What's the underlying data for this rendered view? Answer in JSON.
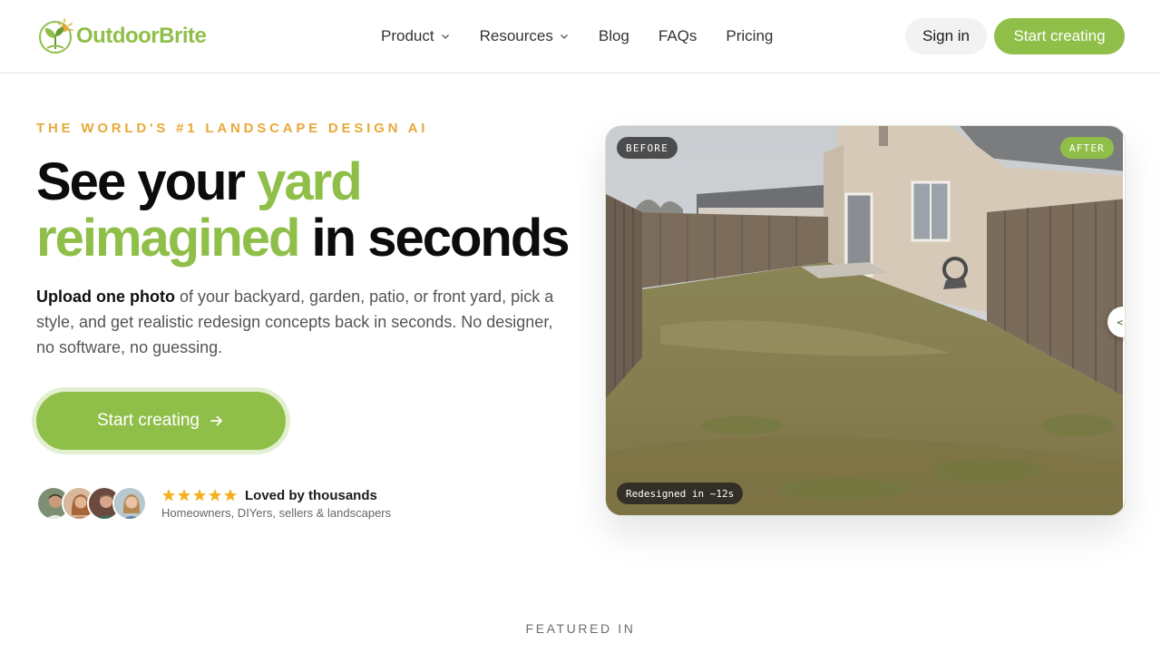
{
  "brand": {
    "name_part1": "Outdoor",
    "name_part2": "Brite",
    "colors": {
      "green": "#8fbf49",
      "orange": "#e8a93a",
      "dark": "#0c0c0c"
    }
  },
  "nav": {
    "items": [
      {
        "label": "Product",
        "has_dropdown": true
      },
      {
        "label": "Resources",
        "has_dropdown": true
      },
      {
        "label": "Blog",
        "has_dropdown": false
      },
      {
        "label": "FAQs",
        "has_dropdown": false
      },
      {
        "label": "Pricing",
        "has_dropdown": false
      }
    ],
    "sign_in": "Sign in",
    "start_creating": "Start creating"
  },
  "hero": {
    "eyebrow": "THE WORLD'S #1 LANDSCAPE DESIGN AI",
    "headline": {
      "part1": "See your ",
      "part2_green": "yard reimagined",
      "part3": " in seconds"
    },
    "subtext": {
      "bold": "Upload one photo",
      "rest": " of your backyard, garden, patio, or front yard, pick a style, and get realistic redesign concepts back in seconds. No designer, no software, no guessing."
    },
    "cta_label": "Start creating",
    "cta_icon": "arrow-right-icon",
    "social_proof": {
      "rating_stars": 5,
      "title": "Loved by thousands",
      "subtitle": "Homeowners, DIYers, sellers & landscapers"
    },
    "compare": {
      "before_label": "BEFORE",
      "after_label": "AFTER",
      "time_label": "Redesigned in ~12s",
      "handle_glyph": "<›"
    }
  },
  "featured_in": "FEATURED IN"
}
